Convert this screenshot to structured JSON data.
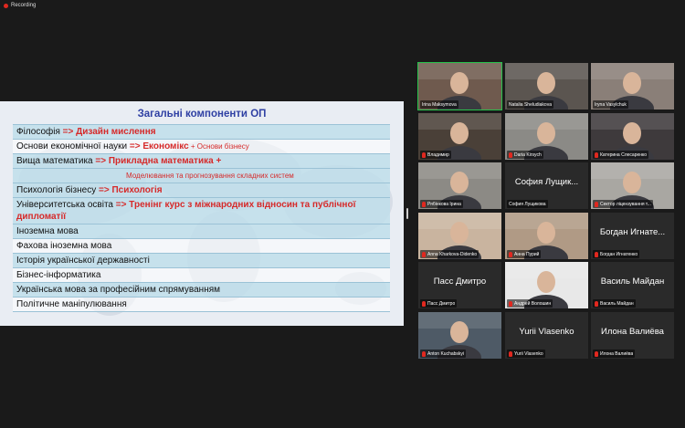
{
  "recording": "Recording",
  "slide": {
    "title": "Загальні компоненти ОП",
    "rows": [
      {
        "main": "Філософія",
        "arrow": " => ",
        "red": "Дизайн мислення",
        "small": ""
      },
      {
        "main": "Основи економічної науки",
        "arrow": " => ",
        "red": "Економікс",
        "small": " + Основи бізнесу"
      },
      {
        "main": "Вища математика",
        "arrow": " => ",
        "red": "Прикладна математика +",
        "small": ""
      },
      {
        "main": "",
        "arrow": "",
        "red": "",
        "small": "Моделювання та прогнозування складних систем"
      },
      {
        "main": "Психологія бізнесу",
        "arrow": " => ",
        "red": "Психологія",
        "small": ""
      },
      {
        "main": "Університетська освіта",
        "arrow": " => ",
        "red": "Тренінг курс з міжнародних відносин та публічної дипломатії",
        "small": ""
      },
      {
        "main": "Іноземна мова",
        "arrow": "",
        "red": "",
        "small": ""
      },
      {
        "main": "Фахова іноземна мова",
        "arrow": "",
        "red": "",
        "small": ""
      },
      {
        "main": "Історія української державності",
        "arrow": "",
        "red": "",
        "small": ""
      },
      {
        "main": "Бізнес-інформатика",
        "arrow": "",
        "red": "",
        "small": ""
      },
      {
        "main": "Українська мова за професійним спрямуванням",
        "arrow": "",
        "red": "",
        "small": ""
      },
      {
        "main": "Політичне маніпулювання",
        "arrow": "",
        "red": "",
        "small": ""
      }
    ]
  },
  "participants": [
    {
      "name": "Irina Maksymova",
      "big": "",
      "video": true,
      "muted": false,
      "active": true
    },
    {
      "name": "Natalia Sheludiakova",
      "big": "",
      "video": true,
      "muted": false,
      "active": false
    },
    {
      "name": "Iryna Vasylchuk",
      "big": "",
      "video": true,
      "muted": false,
      "active": false
    },
    {
      "name": "Владимир",
      "big": "",
      "video": true,
      "muted": true,
      "active": false
    },
    {
      "name": "Daria Kirsych",
      "big": "",
      "video": true,
      "muted": true,
      "active": false
    },
    {
      "name": "Катерина Слесаренко",
      "big": "",
      "video": true,
      "muted": true,
      "active": false
    },
    {
      "name": "Рябінкова Ірина",
      "big": "",
      "video": true,
      "muted": true,
      "active": false
    },
    {
      "name": "София Лущикова",
      "big": "София Лущик...",
      "video": false,
      "muted": false,
      "active": false
    },
    {
      "name": "Сектор ліцензування т...",
      "big": "",
      "video": true,
      "muted": true,
      "active": false
    },
    {
      "name": "Anna Kharkova-Didenko",
      "big": "",
      "video": true,
      "muted": true,
      "active": false
    },
    {
      "name": "Анна Пурий",
      "big": "",
      "video": true,
      "muted": true,
      "active": false
    },
    {
      "name": "Богдан Игнатенко",
      "big": "Богдан Игнате...",
      "video": false,
      "muted": true,
      "active": false
    },
    {
      "name": "Пасс Дмитро",
      "big": "Пасс Дмитро",
      "video": false,
      "muted": true,
      "active": false
    },
    {
      "name": "Андрей Волошин",
      "big": "",
      "video": true,
      "muted": true,
      "active": false
    },
    {
      "name": "Василь Майдан",
      "big": "Василь Майдан",
      "video": false,
      "muted": true,
      "active": false
    },
    {
      "name": "Anton Kuchabskyi",
      "big": "",
      "video": true,
      "muted": true,
      "active": false
    },
    {
      "name": "Yurii Vlasenko",
      "big": "Yurii Vlasenko",
      "video": false,
      "muted": true,
      "active": false
    },
    {
      "name": "Илона Валиёва",
      "big": "Илона Валиёва",
      "video": false,
      "muted": true,
      "active": false
    }
  ],
  "colors": {
    "accent_red": "#d62a2a",
    "title_blue": "#2e3fa3",
    "active_border": "#27c24c"
  }
}
